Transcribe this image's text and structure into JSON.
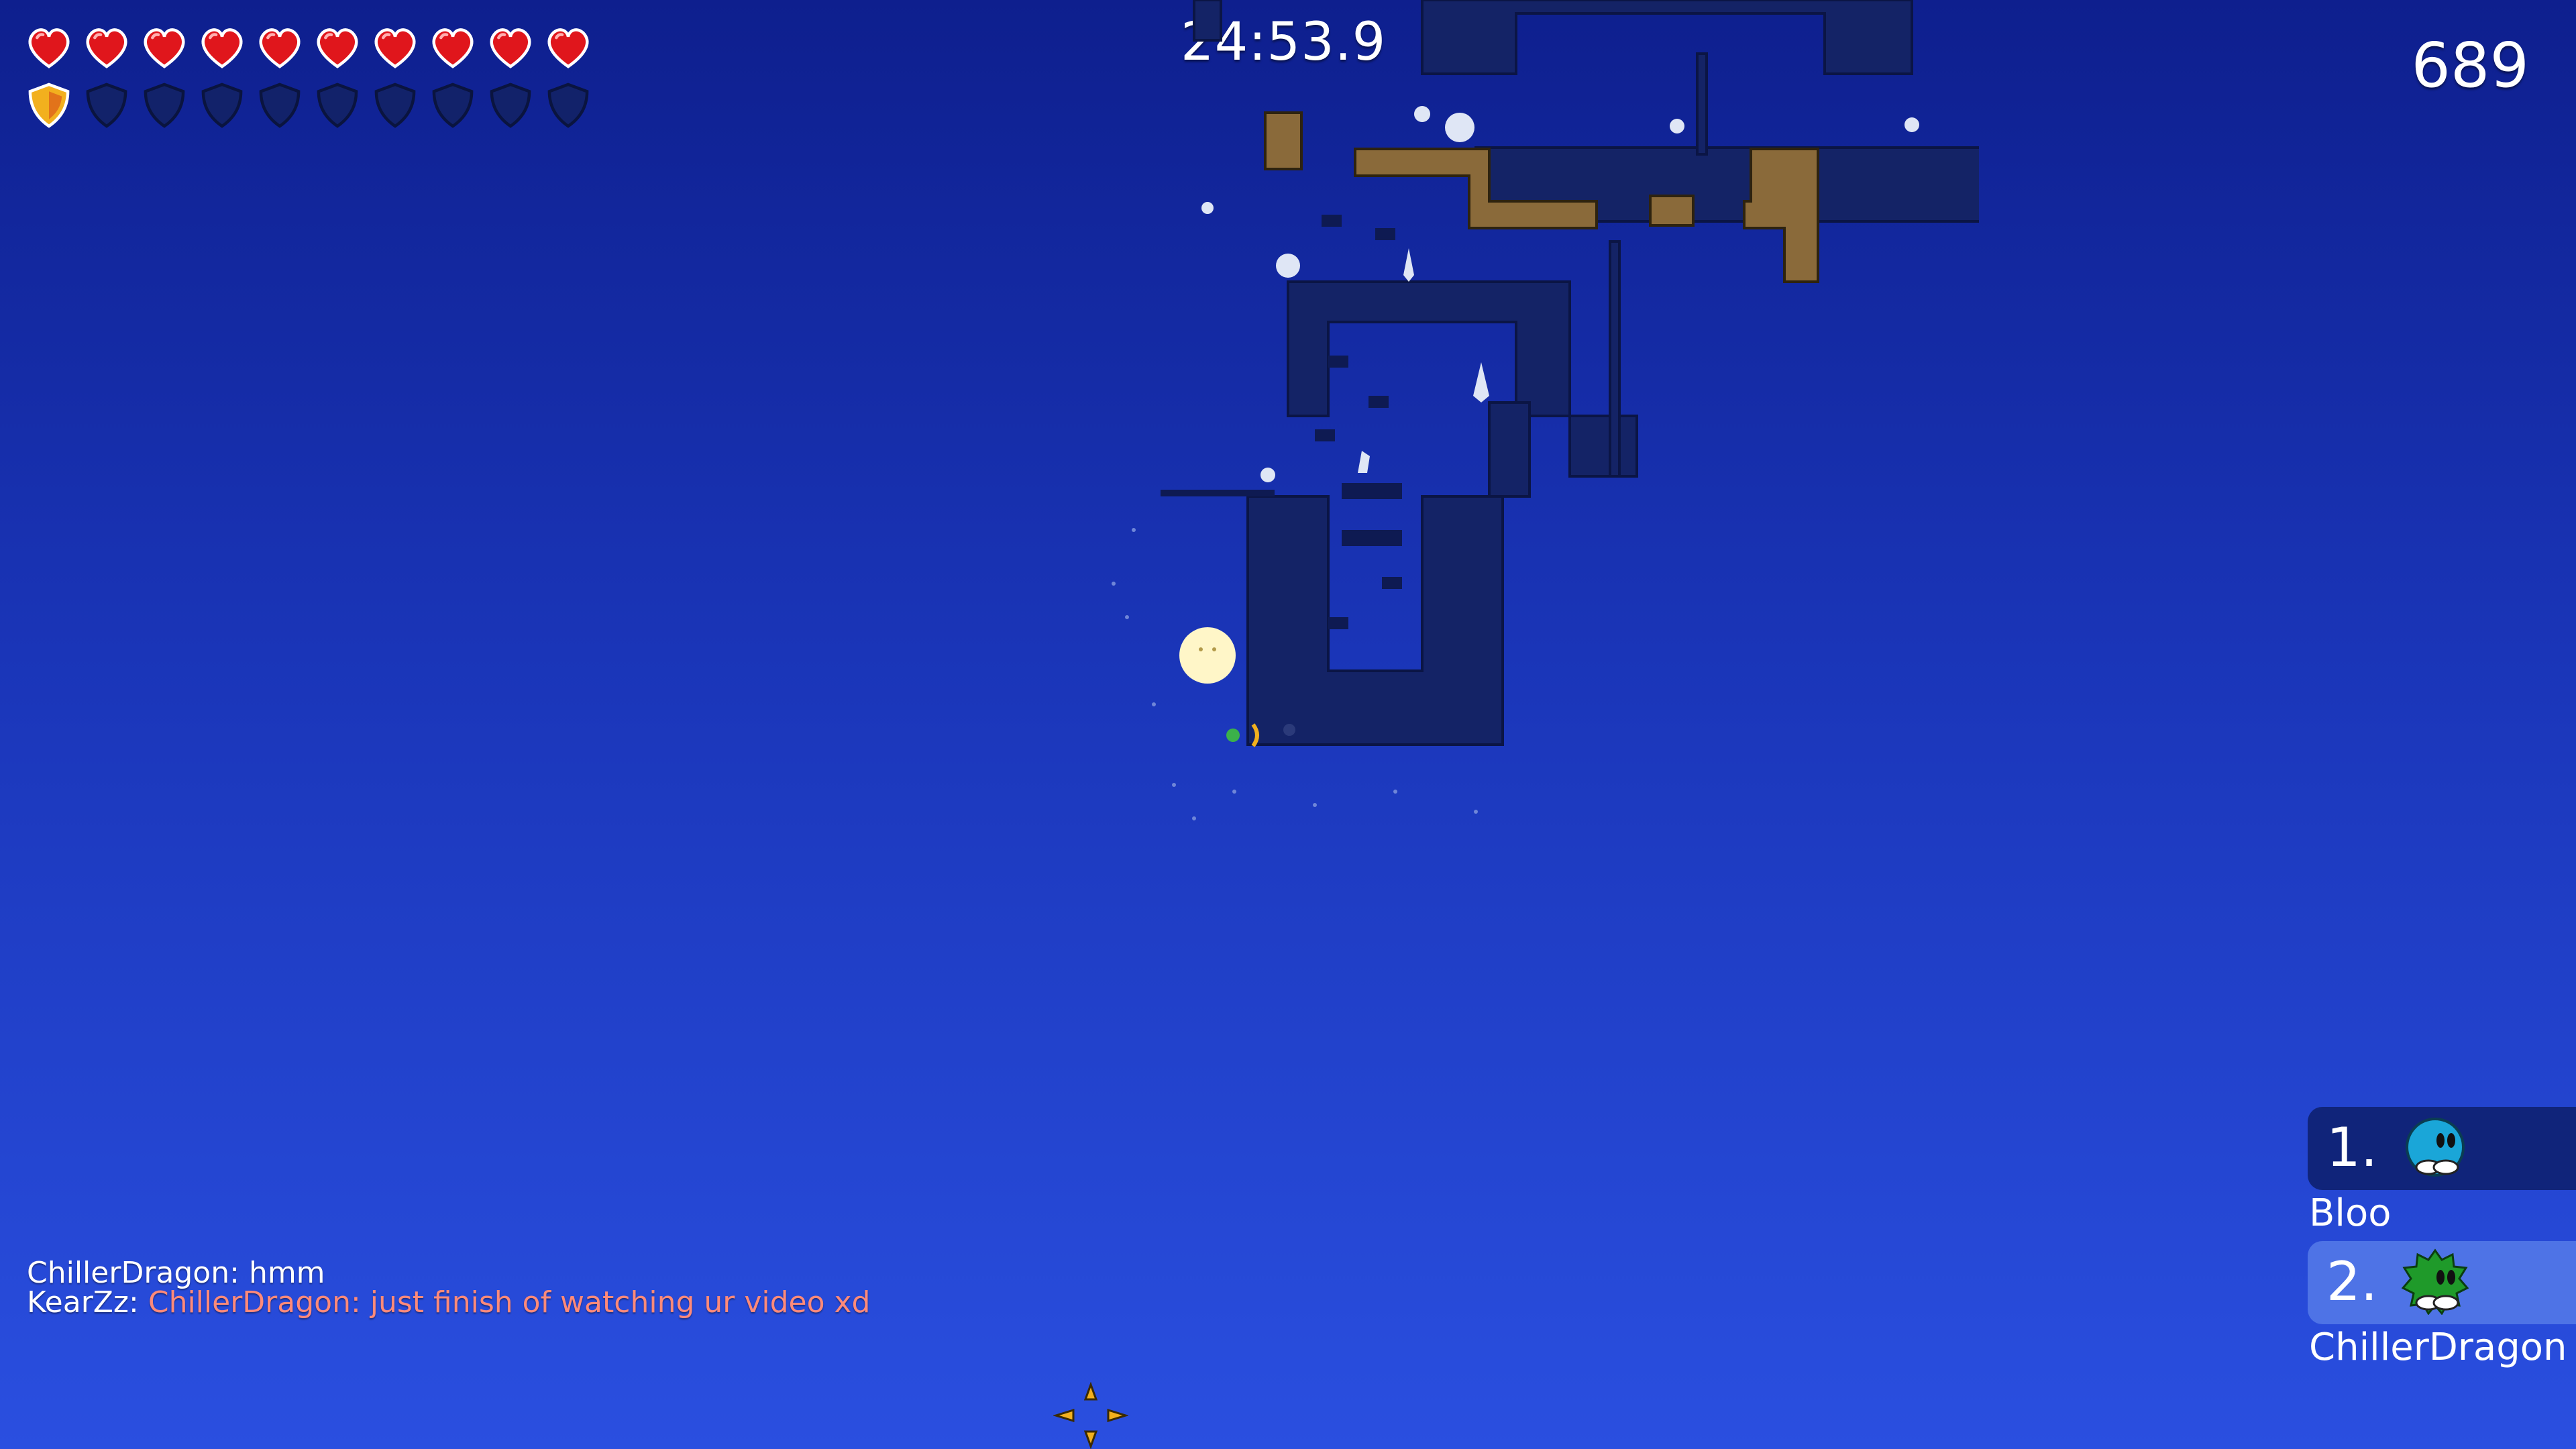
{
  "hud": {
    "health": {
      "current": 10,
      "max": 10
    },
    "armor": {
      "current": 1,
      "max": 10
    },
    "timer": "24:53.9",
    "score": "689"
  },
  "scoreboard": [
    {
      "rank": "1.",
      "name": "Bloo",
      "skin_color": "#1aa6d8"
    },
    {
      "rank": "2.",
      "name": "ChillerDragon",
      "skin_color": "#1f9a2a"
    }
  ],
  "chat": [
    {
      "author": "ChillerDragon: ",
      "message": "hmm",
      "highlight": false
    },
    {
      "author": "KearZz: ",
      "message": "ChillerDragon: just finish of watching ur video xd",
      "highlight": true
    }
  ],
  "colors": {
    "sky_top": "#0e1f8e",
    "sky_bottom": "#2a4fe0",
    "heart": "#e0161c",
    "armor": "#f2b01e",
    "tile_dark": "#142366",
    "tile_brown": "#8a6a3a",
    "highlight_chat": "#ff8a7a"
  }
}
